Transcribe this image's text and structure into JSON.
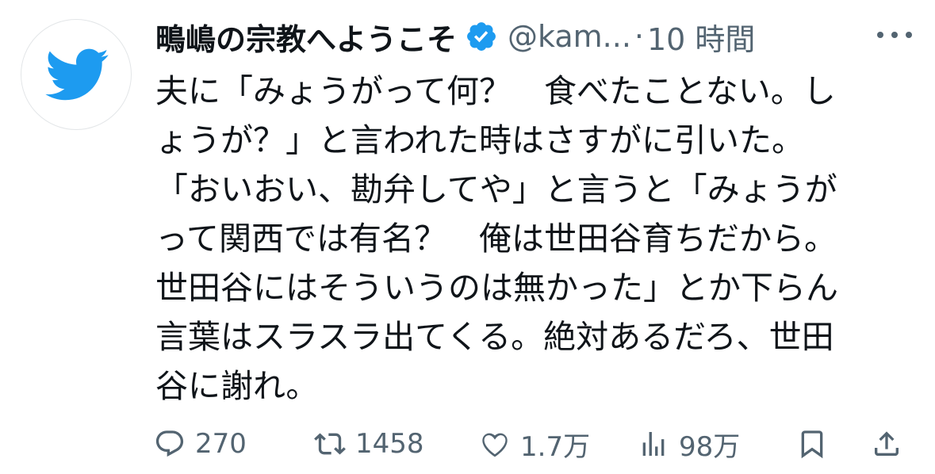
{
  "tweet": {
    "display_name": "鴫嶋の宗教へようこそ",
    "handle": "@kam...",
    "separator": "·",
    "time": "10 時間",
    "text_lines": [
      "夫に「みょうがって何？　食べたことない。し",
      "ょうが？」と言われた時はさすがに引いた。",
      "「おいおい、勘弁してや」と言うと「みょうが",
      "って関西では有名？　俺は世田谷育ちだから。",
      "世田谷にはそういうのは無かった」とか下らん",
      "言葉はスラスラ出てくる。絶対あるだろ、世田",
      "谷に謝れ。"
    ]
  },
  "actions": {
    "reply_count": "270",
    "retweet_count": "1458",
    "like_count": "1.7万",
    "view_count": "98万"
  },
  "colors": {
    "twitter_blue": "#1d9bf0",
    "icon_gray": "#536471",
    "text": "#0f1419"
  },
  "icons": [
    "twitter-bird-icon",
    "verified-badge-icon",
    "more-icon",
    "reply-icon",
    "retweet-icon",
    "like-icon",
    "views-icon",
    "bookmark-icon",
    "share-icon"
  ]
}
